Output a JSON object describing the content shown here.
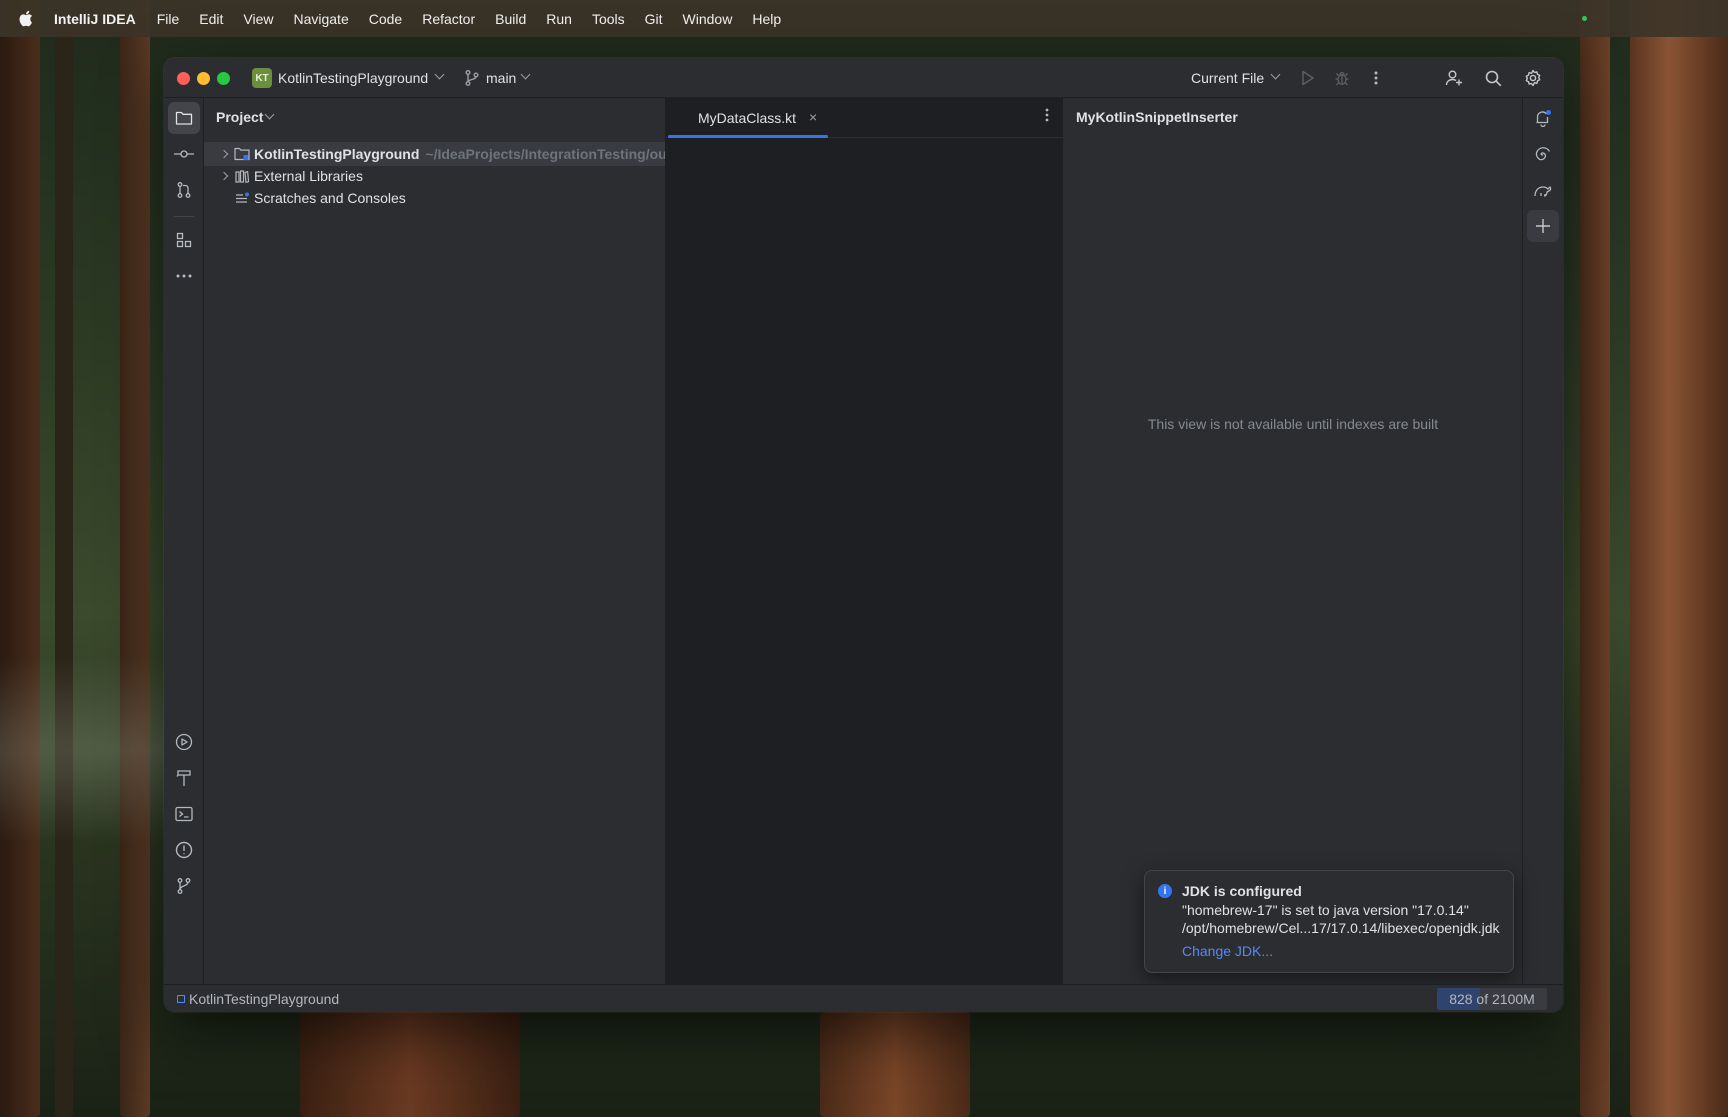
{
  "menubar": {
    "app_name": "IntelliJ IDEA",
    "items": [
      "File",
      "Edit",
      "View",
      "Navigate",
      "Code",
      "Refactor",
      "Build",
      "Run",
      "Tools",
      "Git",
      "Window",
      "Help"
    ]
  },
  "titlebar": {
    "project_badge": "KT",
    "project_name": "KotlinTestingPlayground",
    "branch": "main",
    "run_config": "Current File"
  },
  "project_panel": {
    "title": "Project",
    "tree": [
      {
        "label": "KotlinTestingPlayground",
        "path": "~/IdeaProjects/IntegrationTesting/out/id",
        "expandable": true,
        "selected": true,
        "icon": "module-folder-icon"
      },
      {
        "label": "External Libraries",
        "expandable": true,
        "icon": "library-icon"
      },
      {
        "label": "Scratches and Consoles",
        "expandable": false,
        "icon": "scratches-icon"
      }
    ]
  },
  "editor": {
    "tab_label": "MyDataClass.kt",
    "tab_close": "×"
  },
  "side_panel": {
    "title": "MyKotlinSnippetInserter",
    "empty_text": "This view is not available until indexes are built"
  },
  "notification": {
    "title": "JDK is configured",
    "line1": "\"homebrew-17\" is set to java version \"17.0.14\"",
    "line2": "/opt/homebrew/Cel...17/17.0.14/libexec/openjdk.jdk",
    "link": "Change JDK..."
  },
  "statusbar": {
    "module": "KotlinTestingPlayground",
    "memory_label": "828 of 2100M",
    "memory_used": 828,
    "memory_total": 2100
  },
  "colors": {
    "accent": "#3574f0",
    "link": "#548af7",
    "project_badge": "#6b8f3a"
  }
}
